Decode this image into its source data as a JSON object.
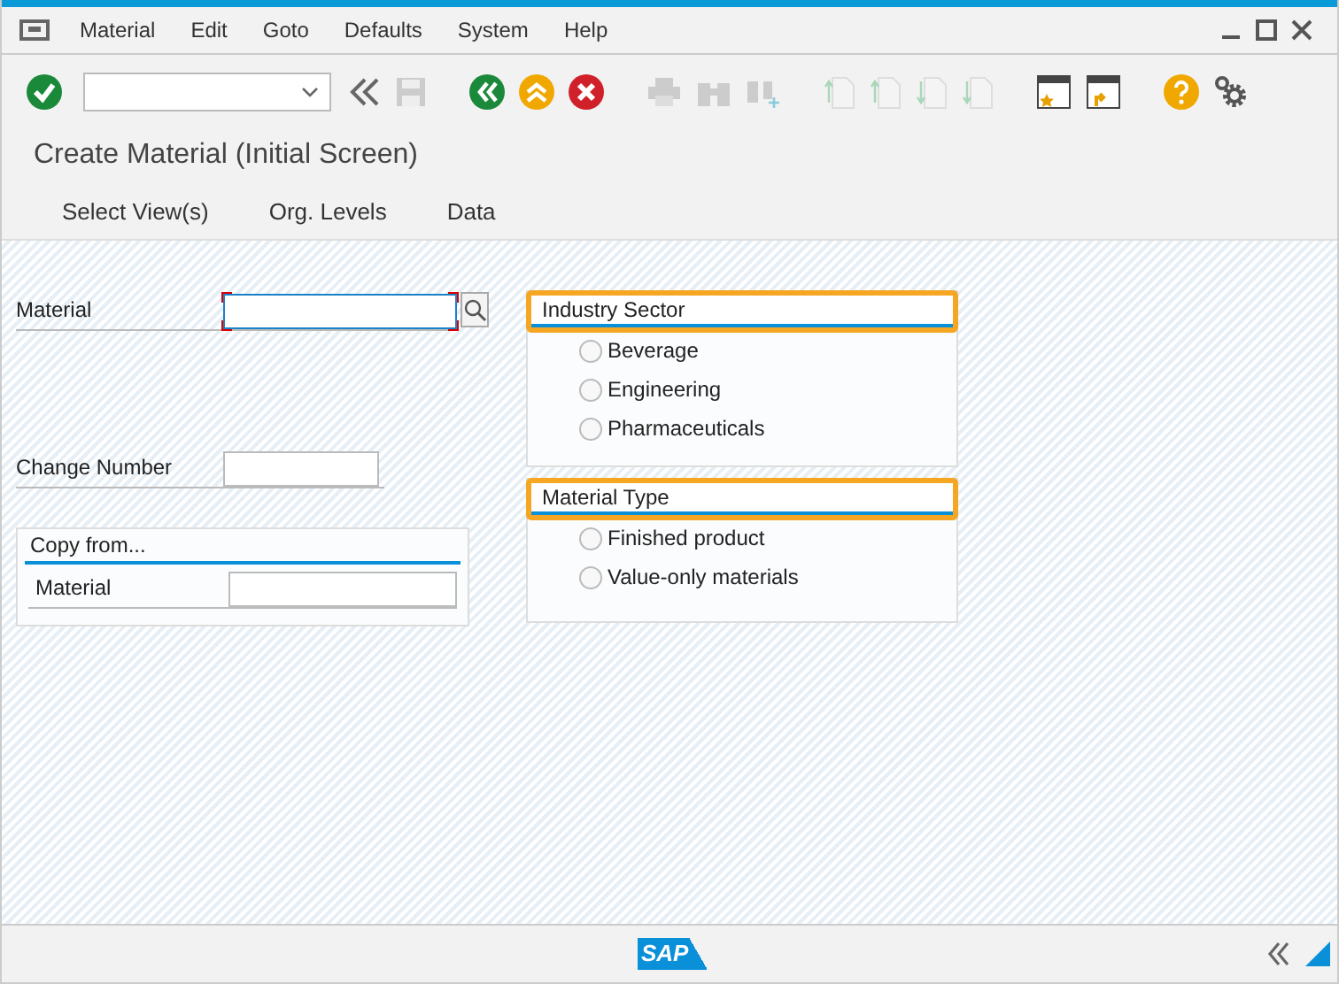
{
  "menu": [
    "Material",
    "Edit",
    "Goto",
    "Defaults",
    "System",
    "Help"
  ],
  "title": "Create Material (Initial Screen)",
  "app_toolbar": [
    "Select View(s)",
    "Org. Levels",
    "Data"
  ],
  "fields": [
    {
      "label": "Material",
      "focused": true,
      "search_help": true
    },
    {
      "label": "Change Number",
      "focused": false,
      "search_help": false
    }
  ],
  "copy_from": {
    "title": "Copy from...",
    "fields": [
      {
        "label": "Material",
        "focused": false
      }
    ]
  },
  "groups": [
    {
      "title": "Industry Sector",
      "options": [
        {
          "label": "Beverage",
          "selected": false
        },
        {
          "label": "Engineering",
          "selected": false
        },
        {
          "label": "Pharmaceuticals",
          "selected": false
        }
      ]
    },
    {
      "title": "Material Type",
      "options": [
        {
          "label": "Finished product",
          "selected": false
        },
        {
          "label": "Value-only materials",
          "selected": false
        }
      ]
    }
  ],
  "status_bar": {
    "logo": "SAP"
  }
}
